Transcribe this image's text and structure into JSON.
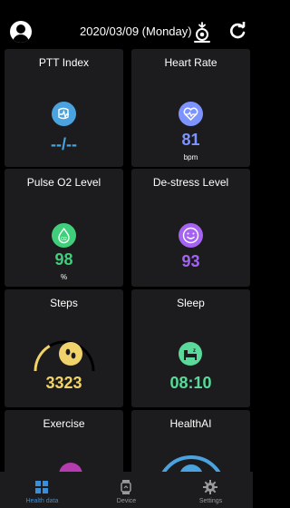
{
  "header": {
    "date": "2020/03/09 (Monday)"
  },
  "cards": {
    "ptt": {
      "title": "PTT Index",
      "value": "--/--",
      "color": "#4aa3df"
    },
    "heart_rate": {
      "title": "Heart Rate",
      "value": "81",
      "unit": "bpm",
      "color": "#7d93ff"
    },
    "pulse_o2": {
      "title": "Pulse O2  Level",
      "value": "98",
      "unit": "%",
      "color": "#3fcf7b"
    },
    "destress": {
      "title": "De-stress Level",
      "value": "93",
      "color": "#a463f2"
    },
    "steps": {
      "title": "Steps",
      "value": "3323",
      "color": "#f0d36a",
      "progress": 0.33
    },
    "sleep": {
      "title": "Sleep",
      "value": "08:10",
      "color": "#59d99a"
    },
    "exercise": {
      "title": "Exercise"
    },
    "healthai": {
      "title": "HealthAI"
    }
  },
  "nav": {
    "items": [
      {
        "label": "Health data",
        "active": true
      },
      {
        "label": "Device",
        "active": false
      },
      {
        "label": "Settings",
        "active": false
      }
    ],
    "active_color": "#3a8fd6",
    "inactive_color": "#9a9a9a"
  }
}
